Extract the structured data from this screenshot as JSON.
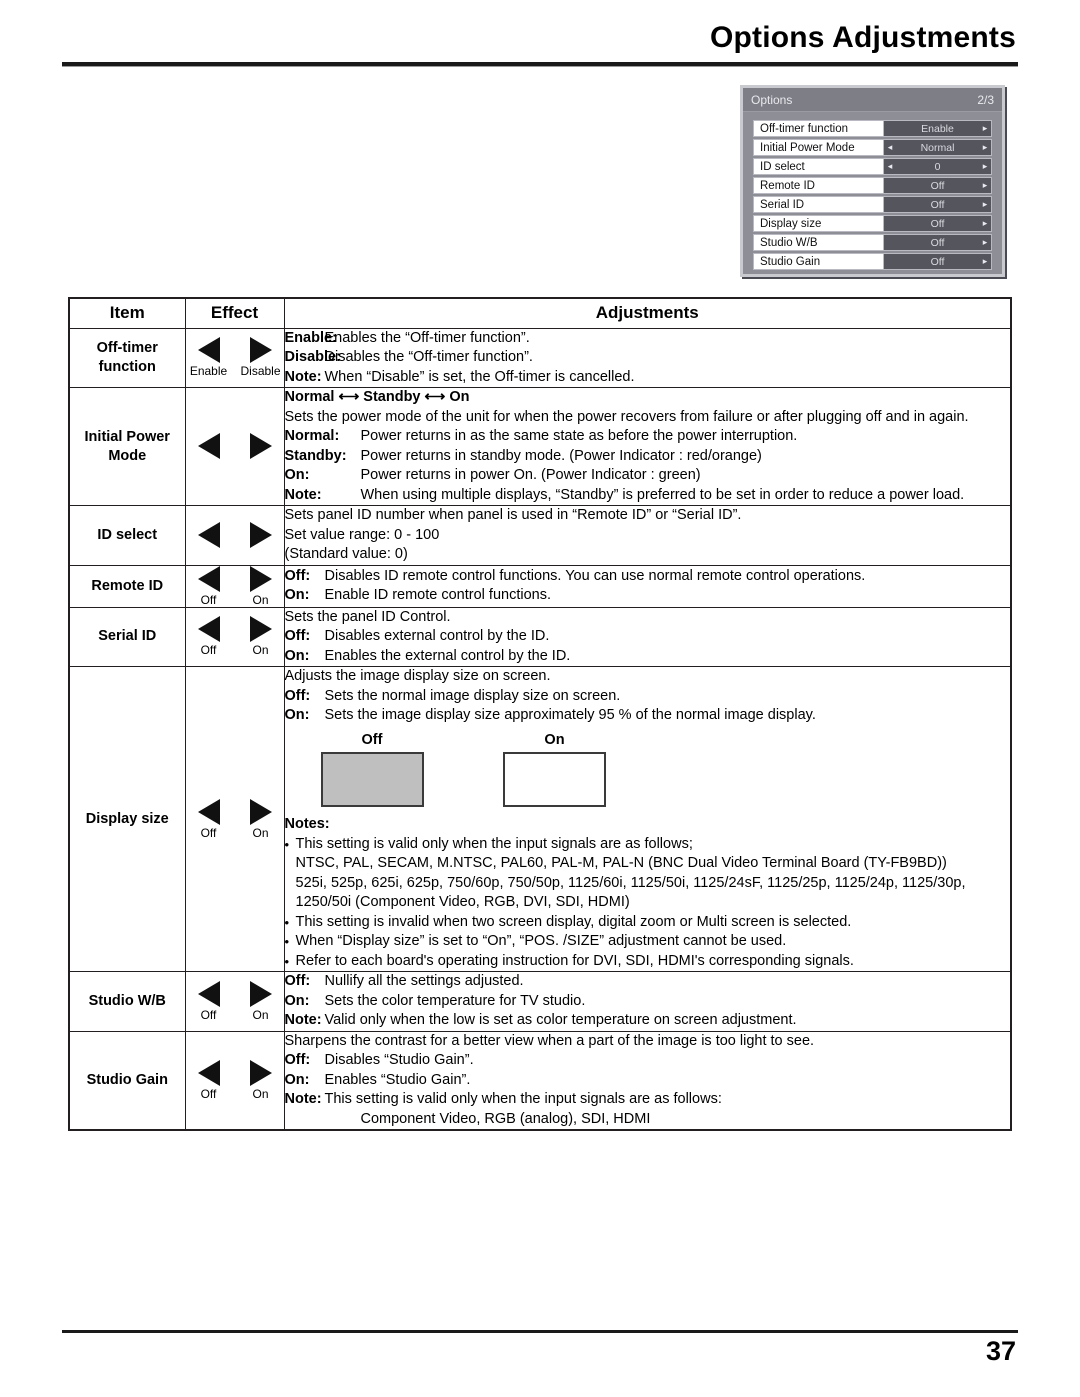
{
  "header": {
    "title": "Options Adjustments"
  },
  "footer": {
    "page_number": "37"
  },
  "osd": {
    "title": "Options",
    "page_indicator": "2/3",
    "rows": [
      {
        "label": "Off-timer function",
        "value": "Enable",
        "left_arrow": "",
        "right_arrow": "▸"
      },
      {
        "label": "Initial Power Mode",
        "value": "Normal",
        "left_arrow": "◂",
        "right_arrow": "▸"
      },
      {
        "label": "ID select",
        "value": "0",
        "left_arrow": "◂",
        "right_arrow": "▸"
      },
      {
        "label": "Remote ID",
        "value": "Off",
        "left_arrow": "",
        "right_arrow": "▸"
      },
      {
        "label": "Serial ID",
        "value": "Off",
        "left_arrow": "",
        "right_arrow": "▸"
      },
      {
        "label": "Display size",
        "value": "Off",
        "left_arrow": "",
        "right_arrow": "▸"
      },
      {
        "label": "Studio W/B",
        "value": "Off",
        "left_arrow": "",
        "right_arrow": "▸"
      },
      {
        "label": "Studio Gain",
        "value": "Off",
        "left_arrow": "",
        "right_arrow": "▸"
      }
    ]
  },
  "table": {
    "headers": {
      "item": "Item",
      "effect": "Effect",
      "adjustments": "Adjustments"
    },
    "rows": {
      "offtimer": {
        "item": "Off-timer function",
        "left_caption": "Enable",
        "right_caption": "Disable",
        "d1_term": "Enable:",
        "d1_desc": "Enables the “Off-timer function”.",
        "d2_term": "Disable:",
        "d2_desc": "Disables the “Off-timer function”.",
        "d3_term": "Note:",
        "d3_desc": "When “Disable” is set, the Off-timer is cancelled."
      },
      "initial_power": {
        "item": "Initial Power Mode",
        "left_caption": "",
        "right_caption": "",
        "cycle": "Normal ⟷ Standby ⟷ On",
        "intro": "Sets the power mode of the unit for when the power recovers from failure or after plugging off and in again.",
        "d1_term": "Normal:",
        "d1_desc": "Power returns in as the same state as before the power interruption.",
        "d2_term": "Standby:",
        "d2_desc": "Power returns in standby mode. (Power Indicator : red/orange)",
        "d3_term": "On:",
        "d3_desc": "Power returns in power On. (Power Indicator : green)",
        "d4_term": "Note:",
        "d4_desc": "When using multiple displays, “Standby” is preferred to be set in order to reduce a power load."
      },
      "id_select": {
        "item": "ID select",
        "left_caption": "",
        "right_caption": "",
        "l1": "Sets panel ID number when panel is used in “Remote ID” or “Serial ID”.",
        "l2": "Set value range: 0 - 100",
        "l3": "(Standard value: 0)"
      },
      "remote_id": {
        "item": "Remote ID",
        "left_caption": "Off",
        "right_caption": "On",
        "d1_term": "Off:",
        "d1_desc": "Disables ID remote control functions. You can use normal remote control operations.",
        "d2_term": "On:",
        "d2_desc": "Enable ID remote control functions."
      },
      "serial_id": {
        "item": "Serial ID",
        "left_caption": "Off",
        "right_caption": "On",
        "intro": "Sets the panel ID Control.",
        "d1_term": "Off:",
        "d1_desc": "Disables external control by the ID.",
        "d2_term": "On:",
        "d2_desc": "Enables the external control by the ID."
      },
      "display_size": {
        "item": "Display size",
        "left_caption": "Off",
        "right_caption": "On",
        "intro": "Adjusts the image display size on screen.",
        "d1_term": "Off:",
        "d1_desc": "Sets the normal image display size on screen.",
        "d2_term": "On:",
        "d2_desc": "Sets the image display size approximately 95 % of the normal image display.",
        "diagram_off_caption": "Off",
        "diagram_on_caption": "On",
        "notes_title": "Notes:",
        "note1": "This setting is valid only when the input signals are as follows;",
        "note1_line2": "NTSC, PAL, SECAM, M.NTSC, PAL60, PAL-M, PAL-N (BNC Dual Video Terminal Board (TY-FB9BD))",
        "note1_line3": "525i, 525p, 625i, 625p, 750/60p, 750/50p, 1125/60i, 1125/50i, 1125/24sF, 1125/25p, 1125/24p, 1125/30p,",
        "note1_line4": "1250/50i (Component Video, RGB, DVI, SDI, HDMI)",
        "note2": "This setting is invalid when two screen display, digital zoom or Multi screen is selected.",
        "note3": "When “Display size” is set to “On”, “POS. /SIZE” adjustment cannot be used.",
        "note4": "Refer to each board's operating instruction for DVI, SDI, HDMI's corresponding signals."
      },
      "studio_wb": {
        "item": "Studio W/B",
        "left_caption": "Off",
        "right_caption": "On",
        "d1_term": "Off:",
        "d1_desc": "Nullify all the settings adjusted.",
        "d2_term": "On:",
        "d2_desc": "Sets the color temperature for TV studio.",
        "d3_term": "Note:",
        "d3_desc": "Valid only when the low is set as color temperature on screen adjustment."
      },
      "studio_gain": {
        "item": "Studio Gain",
        "left_caption": "Off",
        "right_caption": "On",
        "intro": "Sharpens the contrast for a better view when a part of the image is too light to see.",
        "d1_term": "Off:",
        "d1_desc": "Disables “Studio Gain”.",
        "d2_term": "On:",
        "d2_desc": "Enables “Studio Gain”.",
        "d3_term": "Note:",
        "d3_desc": "This setting is valid only when the input signals are as follows:",
        "d3_desc2": "Component Video, RGB (analog), SDI, HDMI"
      }
    }
  }
}
